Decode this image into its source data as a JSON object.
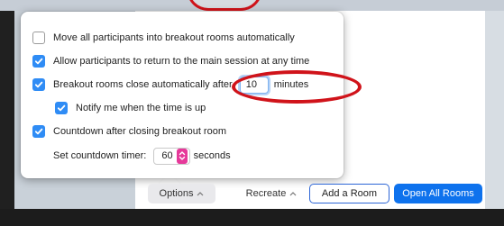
{
  "options": {
    "move_auto": {
      "label": "Move all participants into breakout rooms automatically",
      "checked": false
    },
    "allow_return": {
      "label": "Allow participants to return to the main session at any time",
      "checked": true
    },
    "auto_close": {
      "label_before": "Breakout rooms close automatically after",
      "minutes_value": "10",
      "label_after": "minutes",
      "checked": true
    },
    "notify": {
      "label": "Notify me when the time is up",
      "checked": true
    },
    "countdown": {
      "label": "Countdown after closing breakout room",
      "checked": true
    },
    "countdown_timer": {
      "label": "Set countdown timer:",
      "value": "60",
      "unit": "seconds"
    }
  },
  "footer": {
    "options_label": "Options",
    "recreate_label": "Recreate",
    "add_room_label": "Add a Room",
    "open_all_label": "Open All Rooms"
  },
  "colors": {
    "checkbox_on": "#2f8cf5",
    "primary_button": "#0e72ed",
    "annotation_red": "#d0131a",
    "stepper_pink": "#e6399a"
  }
}
